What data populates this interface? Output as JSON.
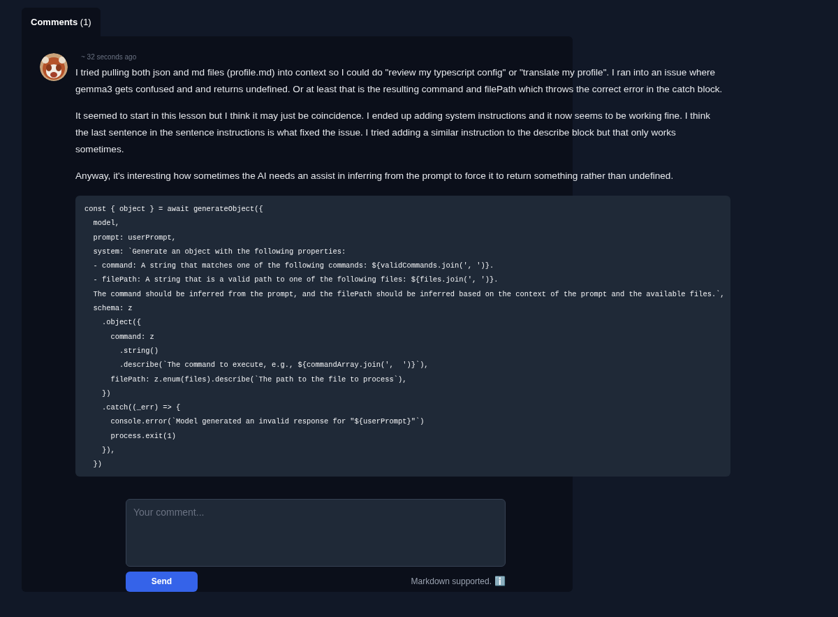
{
  "tabs": [
    {
      "label": "Comments",
      "count": "(1)",
      "selected": true
    }
  ],
  "comments": [
    {
      "time": "~ 32 seconds ago",
      "paragraphs": [
        "I tried pulling both json and md files (profile.md) into context so I could do \"review my typescript config\" or \"translate my profile\". I ran into an issue where gemma3 gets confused and and returns undefined. Or at least that is the resulting command and filePath which throws the correct error in the catch block.",
        "It seemed to start in this lesson but I think it may just be coincidence. I ended up adding system instructions and it now seems to be working fine. I think the last sentence in the sentence instructions is what fixed the issue. I tried adding a similar instruction to the describe block but that only works sometimes.",
        "Anyway, it's interesting how sometimes the AI needs an assist in inferring from the prompt to force it to return something rather than undefined."
      ],
      "code": "const { object } = await generateObject({\n  model,\n  prompt: userPrompt,\n  system: `Generate an object with the following properties:\n  - command: A string that matches one of the following commands: ${validCommands.join(', ')}.\n  - filePath: A string that is a valid path to one of the following files: ${files.join(', ')}.\n  The command should be inferred from the prompt, and the filePath should be inferred based on the context of the prompt and the available files.`,\n  schema: z\n    .object({\n      command: z\n        .string()\n        .describe(`The command to execute, e.g., ${commandArray.join(',  ')}`),\n      filePath: z.enum(files).describe(`The path to the file to process`),\n    })\n    .catch((_err) => {\n      console.error(`Model generated an invalid response for \"${userPrompt}\"`)\n      process.exit(1)\n    }),\n  })"
    }
  ],
  "form": {
    "placeholder": "Your comment...",
    "send": "Send",
    "hint": "Markdown supported.",
    "hint_icon": "ℹ️"
  }
}
